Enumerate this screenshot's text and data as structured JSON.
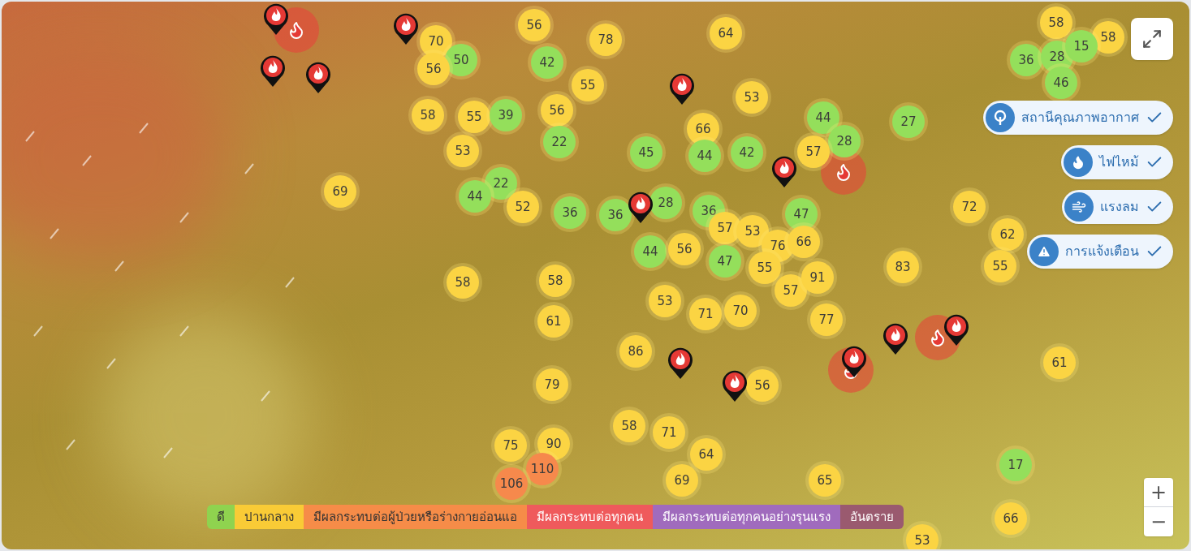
{
  "map": {
    "markers": [
      {
        "value": "56",
        "color": "#fbd443"
      },
      {
        "value": "58",
        "color": "#fbd443"
      },
      {
        "value": "70",
        "color": "#fbd443"
      },
      {
        "value": "78",
        "color": "#fbd443"
      },
      {
        "value": "64",
        "color": "#fbd443"
      },
      {
        "value": "58",
        "color": "#fbd443"
      },
      {
        "value": "50",
        "color": "#94df5b"
      },
      {
        "value": "42",
        "color": "#94df5b"
      },
      {
        "value": "36",
        "color": "#94df5b"
      },
      {
        "value": "28",
        "color": "#94df5b"
      },
      {
        "value": "15",
        "color": "#94df5b"
      },
      {
        "value": "56",
        "color": "#fbd443"
      },
      {
        "value": "55",
        "color": "#fbd443"
      },
      {
        "value": "46",
        "color": "#94df5b"
      },
      {
        "value": "53",
        "color": "#fbd443"
      },
      {
        "value": "58",
        "color": "#fbd443"
      },
      {
        "value": "55",
        "color": "#fbd443"
      },
      {
        "value": "39",
        "color": "#94df5b"
      },
      {
        "value": "56",
        "color": "#fbd443"
      },
      {
        "value": "44",
        "color": "#94df5b"
      },
      {
        "value": "27",
        "color": "#94df5b"
      },
      {
        "value": "66",
        "color": "#fbd443"
      },
      {
        "value": "22",
        "color": "#94df5b"
      },
      {
        "value": "28",
        "color": "#94df5b"
      },
      {
        "value": "53",
        "color": "#fbd443"
      },
      {
        "value": "45",
        "color": "#94df5b"
      },
      {
        "value": "44",
        "color": "#94df5b"
      },
      {
        "value": "42",
        "color": "#94df5b"
      },
      {
        "value": "57",
        "color": "#fbd443"
      },
      {
        "value": "22",
        "color": "#94df5b"
      },
      {
        "value": "69",
        "color": "#fbd443"
      },
      {
        "value": "44",
        "color": "#94df5b"
      },
      {
        "value": "52",
        "color": "#fbd443"
      },
      {
        "value": "36",
        "color": "#94df5b"
      },
      {
        "value": "36",
        "color": "#94df5b"
      },
      {
        "value": "28",
        "color": "#94df5b"
      },
      {
        "value": "36",
        "color": "#94df5b"
      },
      {
        "value": "47",
        "color": "#94df5b"
      },
      {
        "value": "72",
        "color": "#fbd443"
      },
      {
        "value": "57",
        "color": "#fbd443"
      },
      {
        "value": "53",
        "color": "#fbd443"
      },
      {
        "value": "62",
        "color": "#fbd443"
      },
      {
        "value": "44",
        "color": "#94df5b"
      },
      {
        "value": "56",
        "color": "#fbd443"
      },
      {
        "value": "76",
        "color": "#fbd443"
      },
      {
        "value": "66",
        "color": "#fbd443"
      },
      {
        "value": "47",
        "color": "#94df5b"
      },
      {
        "value": "55",
        "color": "#fbd443"
      },
      {
        "value": "83",
        "color": "#fbd443"
      },
      {
        "value": "55",
        "color": "#fbd443"
      },
      {
        "value": "58",
        "color": "#fbd443"
      },
      {
        "value": "58",
        "color": "#fbd443"
      },
      {
        "value": "57",
        "color": "#fbd443"
      },
      {
        "value": "91",
        "color": "#fbd443"
      },
      {
        "value": "53",
        "color": "#fbd443"
      },
      {
        "value": "61",
        "color": "#fbd443"
      },
      {
        "value": "71",
        "color": "#fbd443"
      },
      {
        "value": "70",
        "color": "#fbd443"
      },
      {
        "value": "77",
        "color": "#fbd443"
      },
      {
        "value": "86",
        "color": "#fbd443"
      },
      {
        "value": "61",
        "color": "#fbd443"
      },
      {
        "value": "79",
        "color": "#fbd443"
      },
      {
        "value": "56",
        "color": "#fbd443"
      },
      {
        "value": "58",
        "color": "#fbd443"
      },
      {
        "value": "71",
        "color": "#fbd443"
      },
      {
        "value": "75",
        "color": "#fbd443"
      },
      {
        "value": "90",
        "color": "#fbd443"
      },
      {
        "value": "110",
        "color": "#f6894c"
      },
      {
        "value": "69",
        "color": "#fbd443"
      },
      {
        "value": "64",
        "color": "#fbd443"
      },
      {
        "value": "17",
        "color": "#94df5b"
      },
      {
        "value": "106",
        "color": "#f6894c"
      },
      {
        "value": "65",
        "color": "#fbd443"
      },
      {
        "value": "66",
        "color": "#fbd443"
      },
      {
        "value": "53",
        "color": "#fbd443"
      }
    ]
  },
  "layers": [
    {
      "kind": "station",
      "label": "สถานีคุณภาพอากาศ",
      "checked": true
    },
    {
      "kind": "fire",
      "label": "ไฟไหม้",
      "checked": true
    },
    {
      "kind": "wind",
      "label": "แรงลม",
      "checked": true
    },
    {
      "kind": "alert",
      "label": "การแจ้งเตือน",
      "checked": true
    }
  ],
  "legend": [
    {
      "label": "ดี",
      "color": "#8fd34f"
    },
    {
      "label": "ปานกลาง",
      "color": "#f9cb36"
    },
    {
      "label": "มีผลกระทบต่อผู้ป่วยหรือร่างกายอ่อนแอ",
      "color": "#f68c48"
    },
    {
      "label": "มีผลกระทบต่อทุกคน",
      "color": "#ef5a5c"
    },
    {
      "label": "มีผลกระทบต่อทุกคนอย่างรุนแรง",
      "color": "#a06bbd"
    },
    {
      "label": "อันตราย",
      "color": "#9a5a6f"
    }
  ],
  "zoom": {
    "in": "+",
    "out": "−"
  }
}
